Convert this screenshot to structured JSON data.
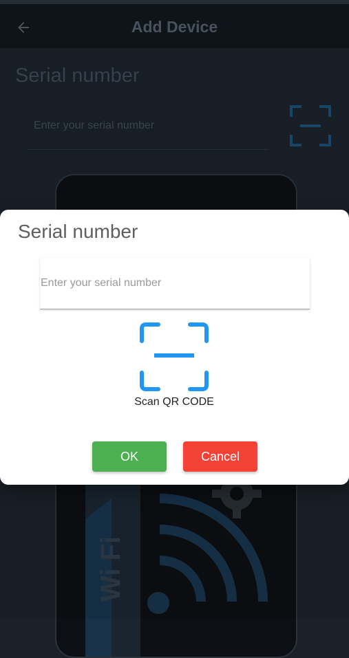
{
  "app_bar": {
    "title": "Add Device",
    "back_icon": "arrow-left-icon"
  },
  "background": {
    "heading": "Serial number",
    "input_placeholder": "Enter your serial number",
    "scan_icon": "qr-scan-icon",
    "card_text": "Wi Fi"
  },
  "dialog": {
    "title": "Serial number",
    "input_placeholder": "Enter your serial number",
    "input_value": "",
    "scan_icon": "qr-scan-icon",
    "scan_label": "Scan QR CODE",
    "ok_label": "OK",
    "cancel_label": "Cancel"
  },
  "colors": {
    "accent": "#2196f3",
    "ok": "#4caf50",
    "cancel": "#f44336"
  }
}
